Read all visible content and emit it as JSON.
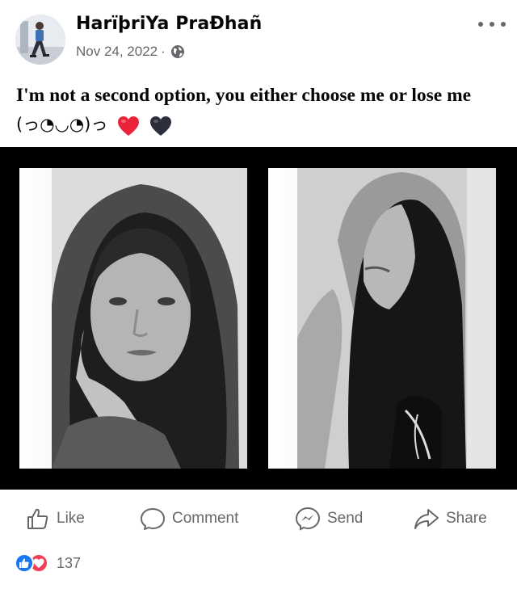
{
  "post": {
    "author": "HarïþriYa PraĐhañ",
    "date": "Nov 24, 2022",
    "separator": "·",
    "privacy_icon": "globe-icon",
    "text_line1": "I'm not a second option, you either choose me or lose me",
    "text_kaomoji": "(っ◔◡◔)っ",
    "emoji": [
      "red-heart",
      "black-heart"
    ]
  },
  "actions": {
    "like": "Like",
    "comment": "Comment",
    "send": "Send",
    "share": "Share"
  },
  "reactions": {
    "types": [
      "like-reaction-icon",
      "love-reaction-icon"
    ],
    "count": "137"
  },
  "colors": {
    "text": "#050505",
    "secondary": "#65676b",
    "like_blue": "#1877f2",
    "love_red": "#f33e58",
    "frame": "#000000"
  }
}
